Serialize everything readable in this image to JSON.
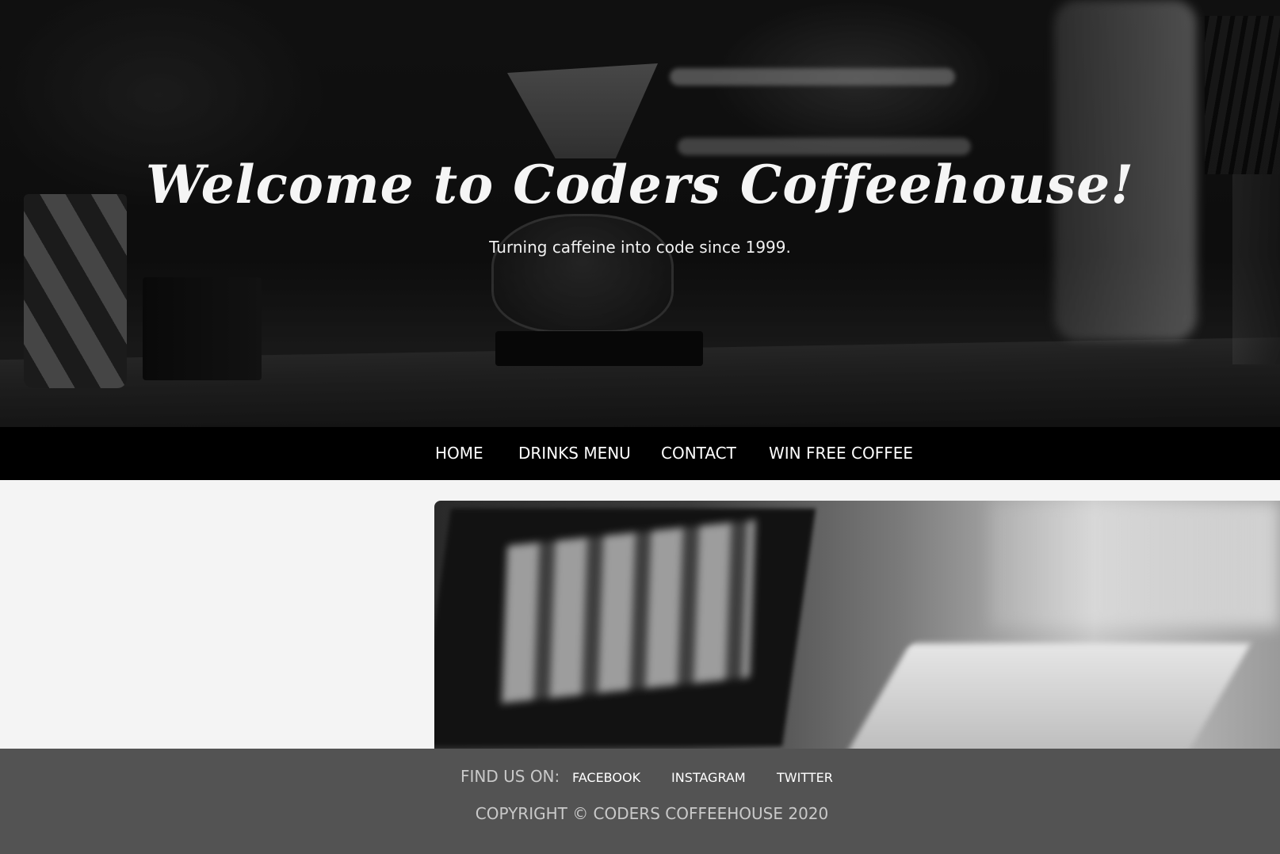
{
  "hero": {
    "title": "Welcome to Coders Coffeehouse!",
    "subtitle": "Turning caffeine into code since 1999."
  },
  "nav": {
    "items": [
      {
        "label": "HOME"
      },
      {
        "label": "DRINKS MENU"
      },
      {
        "label": "CONTACT"
      },
      {
        "label": "WIN FREE COFFEE"
      }
    ]
  },
  "footer": {
    "find_us_label": "FIND US ON:",
    "social": [
      {
        "label": "FACEBOOK"
      },
      {
        "label": "INSTAGRAM"
      },
      {
        "label": "TWITTER"
      }
    ],
    "copyright": "COPYRIGHT © CODERS COFFEEHOUSE 2020"
  },
  "colors": {
    "nav_background": "#000000",
    "footer_background": "#535353",
    "page_background": "#f4f4f4",
    "text_light": "#ffffff",
    "text_muted": "#c9c9c9"
  }
}
